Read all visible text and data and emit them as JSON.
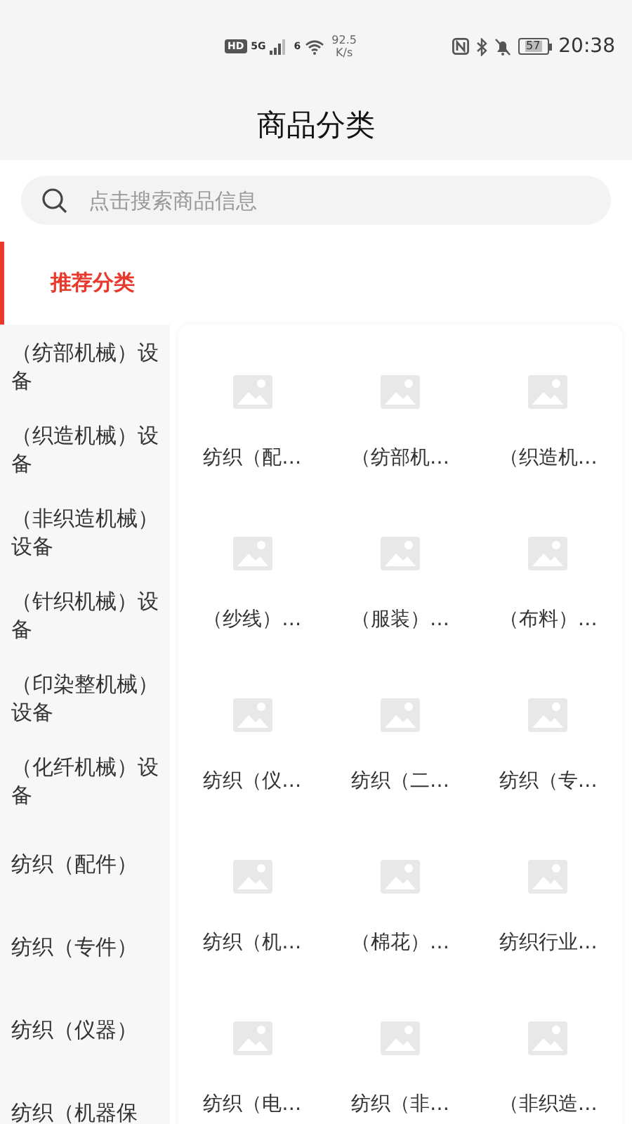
{
  "status_bar": {
    "hd": "HD",
    "signal_label": "5G",
    "wifi_label": "6",
    "speed": "92.5",
    "speed_unit": "K/s",
    "battery": "57",
    "time": "20:38"
  },
  "title": "商品分类",
  "search": {
    "placeholder": "点击搜索商品信息"
  },
  "sidebar": {
    "items": [
      {
        "label": "推荐分类",
        "selected": true
      },
      {
        "label": "（纺部机械）设备",
        "selected": false
      },
      {
        "label": "（织造机械）设备",
        "selected": false
      },
      {
        "label": "（非织造机械）设备",
        "selected": false
      },
      {
        "label": "（针织机械）设备",
        "selected": false
      },
      {
        "label": "（印染整机械）设备",
        "selected": false
      },
      {
        "label": "（化纤机械）设备",
        "selected": false
      },
      {
        "label": "纺织（配件）",
        "selected": false
      },
      {
        "label": "纺织（专件）",
        "selected": false
      },
      {
        "label": "纺织（仪器）",
        "selected": false
      },
      {
        "label": "纺织（机器保",
        "selected": false
      }
    ]
  },
  "grid": {
    "items": [
      {
        "label": "纺织（配…"
      },
      {
        "label": "（纺部机…"
      },
      {
        "label": "（织造机…"
      },
      {
        "label": "（纱线）…"
      },
      {
        "label": "（服装）…"
      },
      {
        "label": "（布料）…"
      },
      {
        "label": "纺织（仪…"
      },
      {
        "label": "纺织（二…"
      },
      {
        "label": "纺织（专…"
      },
      {
        "label": "纺织（机…"
      },
      {
        "label": "（棉花）…"
      },
      {
        "label": "纺织行业…"
      },
      {
        "label": "纺织（电…"
      },
      {
        "label": "纺织（非…"
      },
      {
        "label": "（非织造…"
      }
    ]
  }
}
